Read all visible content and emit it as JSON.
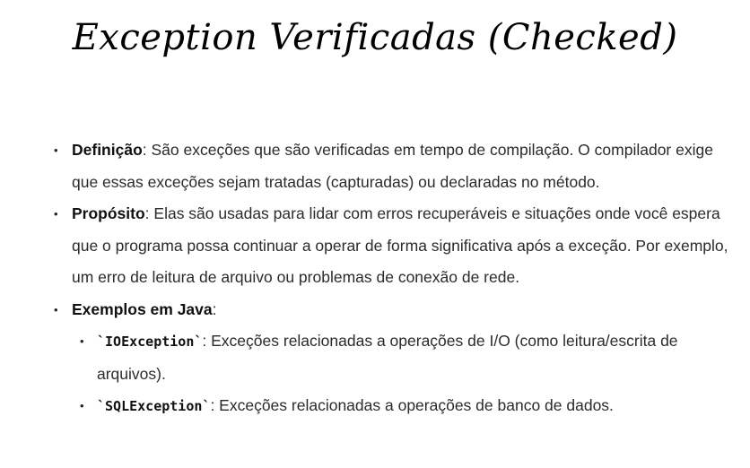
{
  "title": "Exception Verificadas (Checked)",
  "bullets": [
    {
      "term": "Definição",
      "text": ": São exceções que são verificadas em tempo de compilação. O compilador exige que essas exceções sejam tratadas (capturadas) ou declaradas no método."
    },
    {
      "term": "Propósito",
      "text": ": Elas são usadas para lidar com erros recuperáveis e situações onde você espera que o programa possa continuar a operar de forma significativa após a exceção. Por exemplo, um erro de leitura de arquivo ou problemas de conexão de rede."
    },
    {
      "term": "Exemplos em Java",
      "text": ":",
      "sub": [
        {
          "code": "`IOException`",
          "text": ": Exceções relacionadas a operações de I/O (como leitura/escrita de arquivos)."
        },
        {
          "code": "`SQLException`",
          "text": ": Exceções relacionadas a operações de banco de dados."
        }
      ]
    }
  ],
  "bullet_glyph": "•"
}
